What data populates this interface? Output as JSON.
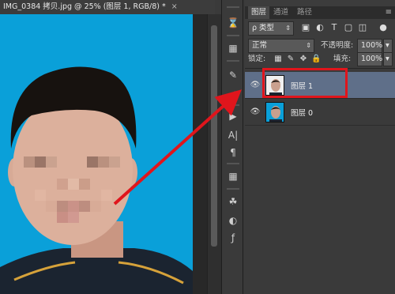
{
  "document": {
    "tab_title": "IMG_0384 拷贝.jpg @ 25% (图层 1, RGB/8) *",
    "close_glyph": "×"
  },
  "tools": [
    {
      "icon": "history-icon",
      "glyph": "⌛"
    },
    {
      "icon": "swatches-icon",
      "glyph": "▦"
    },
    {
      "icon": "brush-presets-icon",
      "glyph": "✎"
    },
    {
      "icon": "adjustments-icon",
      "glyph": "⇌"
    },
    {
      "icon": "play-action-icon",
      "glyph": "▶"
    },
    {
      "icon": "character-icon",
      "glyph": "A|"
    },
    {
      "icon": "paragraph-icon",
      "glyph": "¶"
    },
    {
      "icon": "grid-icon",
      "glyph": "▦"
    },
    {
      "icon": "paint-bucket-icon",
      "glyph": "☘"
    },
    {
      "icon": "styles-icon",
      "glyph": "◐"
    },
    {
      "icon": "fx-icon",
      "glyph": "ƒ"
    }
  ],
  "panel": {
    "tabs": [
      "图层",
      "通道",
      "路径"
    ],
    "active_tab": 0,
    "menu_glyph": "≡",
    "filter_label": "ρ 类型",
    "blend_mode": "正常",
    "opacity_label": "不透明度:",
    "opacity_value": "100%",
    "lock_label": "锁定:",
    "fill_label": "填充:",
    "fill_value": "100%",
    "layers": [
      {
        "name": "图层 1",
        "selected": true
      },
      {
        "name": "图层 0",
        "selected": false
      }
    ]
  },
  "colors": {
    "canvas_bg": "#0aa0d9",
    "selection": "#5f6f89",
    "annotation_red": "#e0151c"
  }
}
